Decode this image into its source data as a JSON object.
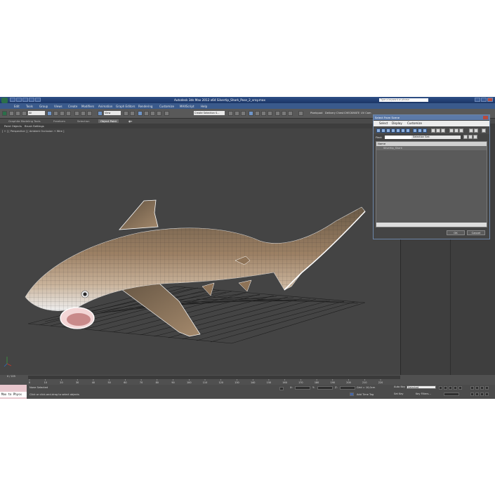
{
  "titlebar": {
    "title": "Autodesk 3ds Max 2012 x64     Silvertip_Shark_Pose_2_vray.max",
    "search_placeholder": "Type a keyword or phrase"
  },
  "menubar": {
    "items": [
      "Edit",
      "Tools",
      "Group",
      "Views",
      "Create",
      "Modifiers",
      "Animation",
      "Graph Editors",
      "Rendering",
      "Customize",
      "MAXScript",
      "Help"
    ]
  },
  "toolbar": {
    "filter_all": "All",
    "view_select": "View",
    "selection_set": "Create Selection S...",
    "right_items": [
      "Pixelquad",
      "Delivery Chest",
      "CHECKMATE",
      "UV Cam"
    ]
  },
  "ribbon": {
    "tabs": [
      "Graphite Modeling Tools",
      "Freeform",
      "Selection",
      "Object Paint"
    ],
    "active_tab": "Object Paint",
    "subitems": [
      "Paint Objects",
      "Brush Settings"
    ]
  },
  "viewport": {
    "label": "[ + ] [ Perspective ] [ Ambient Occlusion + Wire ]"
  },
  "timeline": {
    "frame_counter": "0 / 225",
    "ticks": [
      "0",
      "10",
      "20",
      "30",
      "40",
      "50",
      "60",
      "70",
      "80",
      "90",
      "100",
      "110",
      "120",
      "130",
      "140",
      "150",
      "160",
      "170",
      "180",
      "190",
      "200",
      "210",
      "220"
    ]
  },
  "statusbar": {
    "maxscript_label": "Max to Physx",
    "selection_status": "None Selected",
    "prompt": "Click or click-and-drag to select objects",
    "x_label": "X:",
    "y_label": "Y:",
    "z_label": "Z:",
    "grid": "Grid = 10,0cm",
    "add_time_tag": "Add Time Tag",
    "auto_key": "Auto Key",
    "selected": "Selected",
    "set_key": "Set Key",
    "key_filters": "Key Filters..."
  },
  "dialog": {
    "title": "Select From Scene",
    "menu": [
      "Select",
      "Display",
      "Customize"
    ],
    "find_label": "Find:",
    "selection_set_label": "Selection Set:",
    "column_header": "Name",
    "items": [
      "Silvertip_Shark"
    ],
    "ok": "OK",
    "cancel": "Cancel"
  },
  "colors": {
    "titlebar": "#1b3566",
    "viewport_bg": "#444444",
    "dialog_accent": "#5c7aa8",
    "maxscript_bg": "#e8c7cd"
  }
}
